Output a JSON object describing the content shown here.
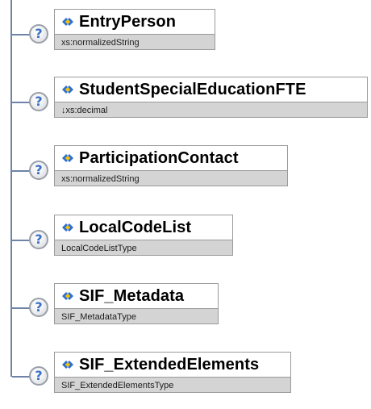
{
  "icon_legend": {
    "occurrence_icon": "question-mark-circle-icon",
    "element_icon": "blue-diamond-arrows-icon"
  },
  "occurrence_symbol": "?",
  "nodes": [
    {
      "name": "EntryPerson",
      "type": "xs:normalizedString"
    },
    {
      "name": "StudentSpecialEducationFTE",
      "type": "↓xs:decimal"
    },
    {
      "name": "ParticipationContact",
      "type": "xs:normalizedString"
    },
    {
      "name": "LocalCodeList",
      "type": "LocalCodeListType"
    },
    {
      "name": "SIF_Metadata",
      "type": "SIF_MetadataType"
    },
    {
      "name": "SIF_ExtendedElements",
      "type": "SIF_ExtendedElementsType"
    }
  ],
  "colors": {
    "connector": "#6e83a8",
    "node_border": "#9a9a9a",
    "node_type_bg": "#d4d4d4",
    "node_shadow": "#8f8f8f",
    "question_mark": "#3a6fc4",
    "element_icon_blue": "#2f6fd0"
  }
}
